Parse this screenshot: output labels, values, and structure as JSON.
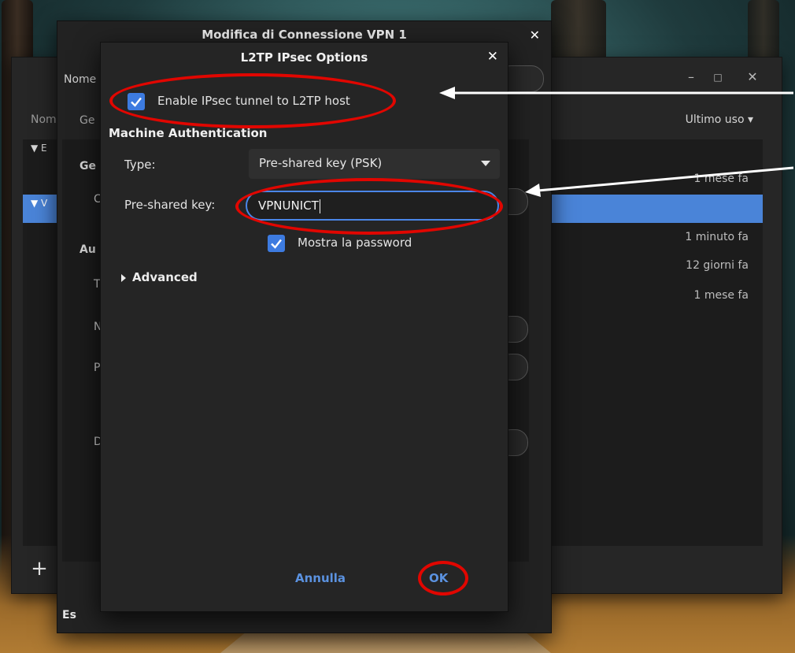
{
  "background": {
    "scene": "forest"
  },
  "back_window": {
    "name_label_partial": "Nom",
    "column_last_used": "Ultimo uso",
    "group_partial": "E",
    "selected_partial": "V",
    "rows": [
      "1 mese fa",
      "1 minuto fa",
      "12 giorni fa",
      "1 mese fa"
    ],
    "add_label": "+"
  },
  "middle_window": {
    "title": "Modifica di Connessione VPN 1",
    "name_label_partial": "Nome",
    "tab_partial": "Ge",
    "section_general_partial": "Ge",
    "section_auth_partial": "Au",
    "label_c": "C",
    "label_t": "T",
    "label_n": "N",
    "label_p": "P",
    "label_d": "D",
    "bottom_label_partial": "Es"
  },
  "dialog": {
    "title": "L2TP IPsec Options",
    "enable_ipsec_label": "Enable IPsec tunnel to L2TP host",
    "enable_ipsec_checked": true,
    "section_title": "Machine Authentication",
    "type_label": "Type:",
    "type_value": "Pre-shared key (PSK)",
    "psk_label": "Pre-shared key:",
    "psk_value": "VPNUNICT",
    "show_password_label": "Mostra la password",
    "show_password_checked": true,
    "advanced_label": "Advanced",
    "cancel_label": "Annulla",
    "ok_label": "OK"
  },
  "colors": {
    "accent": "#4a86e8",
    "annotation": "#e10600",
    "selection": "#4a84d8"
  }
}
